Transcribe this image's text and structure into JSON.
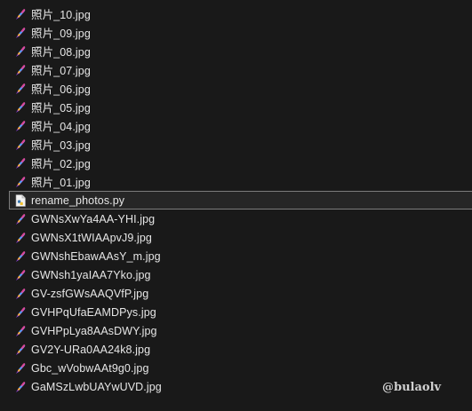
{
  "files": [
    {
      "name": "照片_10.jpg",
      "icon": "image-file-icon"
    },
    {
      "name": "照片_09.jpg",
      "icon": "image-file-icon"
    },
    {
      "name": "照片_08.jpg",
      "icon": "image-file-icon"
    },
    {
      "name": "照片_07.jpg",
      "icon": "image-file-icon"
    },
    {
      "name": "照片_06.jpg",
      "icon": "image-file-icon"
    },
    {
      "name": "照片_05.jpg",
      "icon": "image-file-icon"
    },
    {
      "name": "照片_04.jpg",
      "icon": "image-file-icon"
    },
    {
      "name": "照片_03.jpg",
      "icon": "image-file-icon"
    },
    {
      "name": "照片_02.jpg",
      "icon": "image-file-icon"
    },
    {
      "name": "照片_01.jpg",
      "icon": "image-file-icon"
    },
    {
      "name": "rename_photos.py",
      "icon": "python-file-icon",
      "selected": true
    },
    {
      "name": "GWNsXwYa4AA-YHI.jpg",
      "icon": "image-file-icon"
    },
    {
      "name": "GWNsX1tWIAApvJ9.jpg",
      "icon": "image-file-icon"
    },
    {
      "name": "GWNshEbawAAsY_m.jpg",
      "icon": "image-file-icon"
    },
    {
      "name": "GWNsh1yaIAA7Yko.jpg",
      "icon": "image-file-icon"
    },
    {
      "name": "GV-zsfGWsAAQVfP.jpg",
      "icon": "image-file-icon"
    },
    {
      "name": "GVHPqUfaEAMDPys.jpg",
      "icon": "image-file-icon"
    },
    {
      "name": "GVHPpLya8AAsDWY.jpg",
      "icon": "image-file-icon"
    },
    {
      "name": "GV2Y-URa0AA24k8.jpg",
      "icon": "image-file-icon"
    },
    {
      "name": "Gbc_wVobwAAt9g0.jpg",
      "icon": "image-file-icon"
    },
    {
      "name": "GaMSzLwbUAYwUVD.jpg",
      "icon": "image-file-icon"
    }
  ],
  "watermark": "@bulaolv",
  "colors": {
    "background": "#191919",
    "text": "#e6e6e6",
    "selected_background": "#262626",
    "selected_border": "#7c7c7c"
  }
}
